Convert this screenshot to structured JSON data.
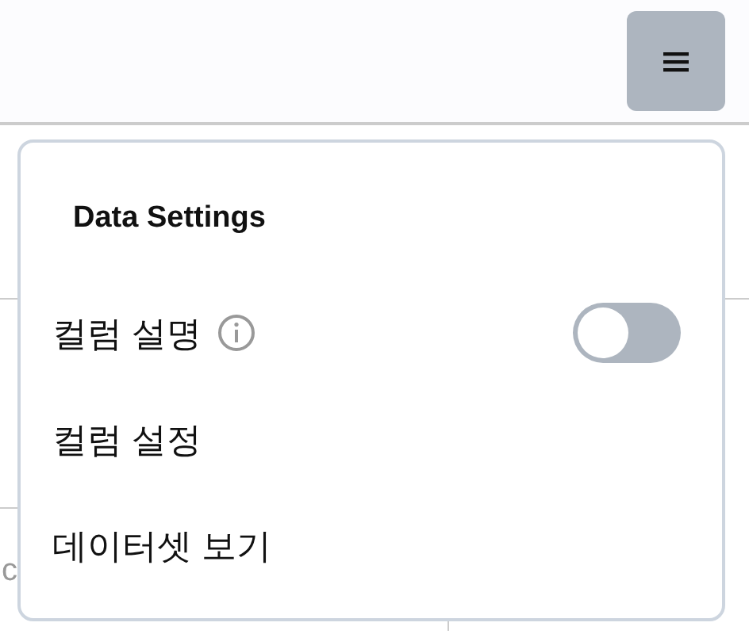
{
  "background": {
    "field_text": "c"
  },
  "menu": {
    "title": "Data Settings",
    "items": [
      {
        "kind": "toggle",
        "label": "컬럼 설명",
        "info": true,
        "on": false
      },
      {
        "kind": "link",
        "label": "컬럼 설정"
      },
      {
        "kind": "link",
        "label": "데이터셋 보기"
      }
    ]
  }
}
